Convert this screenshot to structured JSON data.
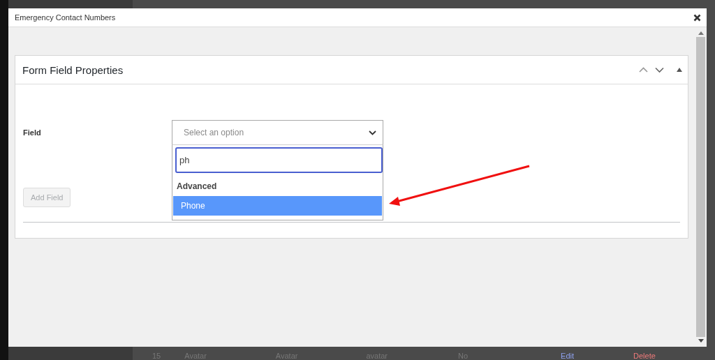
{
  "window": {
    "title": "Emergency Contact Numbers"
  },
  "panel": {
    "title": "Form Field Properties",
    "field": {
      "label": "Field",
      "placeholder": "Select an option",
      "expanded": true,
      "search": {
        "value": "ph"
      },
      "groups": [
        {
          "label": "Advanced",
          "options": [
            {
              "label": "Phone",
              "selected": true
            }
          ]
        }
      ]
    },
    "button": {
      "label": "Add Field",
      "disabled": true
    }
  },
  "background_row": [
    {
      "text": "15",
      "kind": "text"
    },
    {
      "text": "Avatar",
      "kind": "text"
    },
    {
      "text": "Avatar",
      "kind": "text"
    },
    {
      "text": "avatar",
      "kind": "text"
    },
    {
      "text": "No",
      "kind": "text"
    },
    {
      "text": "Edit",
      "kind": "edit_link"
    },
    {
      "text": "Delete",
      "kind": "delete_link"
    }
  ]
}
